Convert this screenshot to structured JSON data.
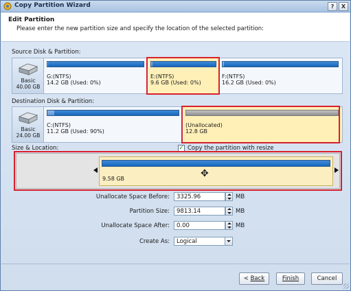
{
  "window": {
    "title": "Copy Partition Wizard",
    "help_label": "?",
    "close_label": "X"
  },
  "header": {
    "title": "Edit Partition",
    "subtitle": "Please enter the new partition size and specify the location of the selected partition:"
  },
  "source": {
    "label": "Source Disk & Partition:",
    "disk": {
      "type": "Basic",
      "size": "40.00 GB"
    },
    "partitions": [
      {
        "name": "G:(NTFS)",
        "info": "14.2 GB (Used: 0%)",
        "used": 0
      },
      {
        "name": "E:(NTFS)",
        "info": "9.6 GB (Used: 0%)",
        "used": 0
      },
      {
        "name": "F:(NTFS)",
        "info": "16.2 GB (Used: 0%)",
        "used": 0
      }
    ]
  },
  "destination": {
    "label": "Destination Disk & Partition:",
    "disk": {
      "type": "Basic",
      "size": "24.00 GB"
    },
    "partitions": [
      {
        "name": "C:(NTFS)",
        "info": "11.2 GB (Used: 90%)",
        "used": 0.9
      },
      {
        "name": "(Unallocated)",
        "info": "12.8 GB"
      }
    ]
  },
  "size_location": {
    "label": "Size & Location:",
    "copy_resize_label": "Copy the partition with resize",
    "copy_resize_checked": true,
    "partition_size_text": "9.58 GB"
  },
  "form": {
    "unalloc_before_label": "Unallocate Space Before:",
    "unalloc_before_value": "3325.96",
    "partition_size_label": "Partition Size:",
    "partition_size_value": "9813.14",
    "unalloc_after_label": "Unallocate Space After:",
    "unalloc_after_value": "0.00",
    "unit": "MB",
    "create_as_label": "Create As:",
    "create_as_value": "Logical"
  },
  "buttons": {
    "back_label": "Back",
    "finish_label": "Finish",
    "cancel_label": "Cancel"
  },
  "colors": {
    "selection": "#fff0b8",
    "highlight_box": "#d8202b",
    "bar_blue": "#1767be"
  }
}
